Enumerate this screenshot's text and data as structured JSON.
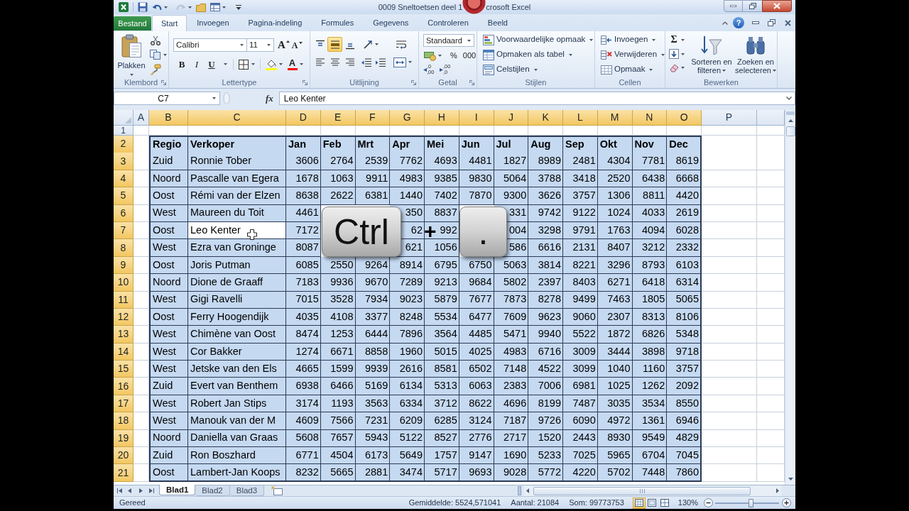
{
  "title_bar": {
    "title_parts": [
      "0009 Sneltoetsen deel 1",
      "crosoft Excel"
    ]
  },
  "ribbon_tabs": [
    {
      "label": "Bestand",
      "kind": "file",
      "selected": false
    },
    {
      "label": "Start",
      "kind": "tab",
      "selected": true
    },
    {
      "label": "Invoegen",
      "kind": "tab",
      "selected": false
    },
    {
      "label": "Pagina-indeling",
      "kind": "tab",
      "selected": false
    },
    {
      "label": "Formules",
      "kind": "tab",
      "selected": false
    },
    {
      "label": "Gegevens",
      "kind": "tab",
      "selected": false
    },
    {
      "label": "Controleren",
      "kind": "tab",
      "selected": false
    },
    {
      "label": "Beeld",
      "kind": "tab",
      "selected": false
    }
  ],
  "window_controls": {
    "help": "?"
  },
  "ribbon": {
    "clipboard": {
      "label": "Klembord",
      "paste": "Plakken"
    },
    "font": {
      "label": "Lettertype",
      "font_name": "Calibri",
      "font_size": "11",
      "size_buttons": [
        {
          "label": "A",
          "kind": "grow"
        },
        {
          "label": "A",
          "kind": "shrink"
        }
      ],
      "style_buttons": [
        {
          "label": "B",
          "kind": "bold"
        },
        {
          "label": "I",
          "kind": "italic"
        },
        {
          "label": "U",
          "kind": "underline"
        }
      ],
      "font_color": "A"
    },
    "alignment": {
      "label": "Uitlijning",
      "vertical": [
        {
          "kind": "top",
          "selected": false
        },
        {
          "kind": "middle",
          "selected": true
        },
        {
          "kind": "bottom",
          "selected": false
        }
      ],
      "horizontal": [
        {
          "kind": "left",
          "selected": false
        },
        {
          "kind": "center",
          "selected": false
        },
        {
          "kind": "right",
          "selected": false
        }
      ]
    },
    "number": {
      "label": "Getal",
      "format": "Standaard",
      "symbols": [
        "%",
        "000"
      ],
      "decimal_buttons": [
        {
          "kind": "increase",
          "top": ",0",
          "bottom": ",00"
        },
        {
          "kind": "decrease",
          "top": ",00",
          "bottom": ",0"
        }
      ]
    },
    "styles": {
      "label": "Stijlen",
      "items": [
        {
          "label": "Voorwaardelijke opmaak",
          "kind": "conditional"
        },
        {
          "label": "Opmaken als tabel",
          "kind": "table"
        },
        {
          "label": "Celstijlen",
          "kind": "cellstyles"
        }
      ]
    },
    "cells": {
      "label": "Cellen",
      "items": [
        {
          "label": "Invoegen",
          "kind": "insert"
        },
        {
          "label": "Verwijderen",
          "kind": "delete"
        },
        {
          "label": "Opmaak",
          "kind": "format"
        }
      ]
    },
    "editing": {
      "label": "Bewerken",
      "sum": "Σ",
      "big_buttons": [
        {
          "kind": "sort",
          "lines": [
            "Sorteren en",
            "filteren"
          ]
        },
        {
          "kind": "find",
          "lines": [
            "Zoeken en",
            "selecteren"
          ]
        }
      ]
    }
  },
  "formula_bar": {
    "name_box": "C7",
    "fx": "fx",
    "formula": "Leo Kenter"
  },
  "sheet": {
    "columns": [
      {
        "label": "A",
        "selected": false,
        "kind": "text"
      },
      {
        "label": "B",
        "selected": true,
        "kind": "text"
      },
      {
        "label": "C",
        "selected": true,
        "kind": "text"
      },
      {
        "label": "D",
        "selected": true,
        "kind": "number"
      },
      {
        "label": "E",
        "selected": true,
        "kind": "number"
      },
      {
        "label": "F",
        "selected": true,
        "kind": "number"
      },
      {
        "label": "G",
        "selected": true,
        "kind": "number"
      },
      {
        "label": "H",
        "selected": true,
        "kind": "number"
      },
      {
        "label": "I",
        "selected": true,
        "kind": "number"
      },
      {
        "label": "J",
        "selected": true,
        "kind": "number"
      },
      {
        "label": "K",
        "selected": true,
        "kind": "number"
      },
      {
        "label": "L",
        "selected": true,
        "kind": "number"
      },
      {
        "label": "M",
        "selected": true,
        "kind": "number"
      },
      {
        "label": "N",
        "selected": true,
        "kind": "number"
      },
      {
        "label": "O",
        "selected": true,
        "kind": "number"
      },
      {
        "label": "P",
        "selected": false,
        "kind": "text"
      }
    ],
    "rows": [
      {
        "number": "1",
        "selected": false,
        "kind": "blank"
      },
      {
        "number": "2",
        "selected": true,
        "kind": "header",
        "cells": [
          null,
          "Regio",
          "Verkoper",
          "Jan",
          "Feb",
          "Mrt",
          "Apr",
          "Mei",
          "Jun",
          "Jul",
          "Aug",
          "Sep",
          "Okt",
          "Nov",
          "Dec",
          null
        ]
      },
      {
        "number": "3",
        "selected": true,
        "kind": "data",
        "cells": [
          null,
          "Zuid",
          "Ronnie Tober",
          "3606",
          "2764",
          "2539",
          "7762",
          "4693",
          "4481",
          "1827",
          "8989",
          "2481",
          "4304",
          "7781",
          "8619",
          null
        ]
      },
      {
        "number": "4",
        "selected": true,
        "kind": "data",
        "cells": [
          null,
          "Noord",
          "Pascalle van Egera",
          "1678",
          "1063",
          "9911",
          "4983",
          "9385",
          "9830",
          "5064",
          "3788",
          "3418",
          "2520",
          "6438",
          "6668",
          null
        ]
      },
      {
        "number": "5",
        "selected": true,
        "kind": "data",
        "cells": [
          null,
          "Oost",
          "Rémi van der Elzen",
          "8638",
          "2622",
          "6381",
          "1440",
          "7402",
          "7870",
          "9300",
          "3626",
          "3757",
          "1306",
          "8811",
          "4420",
          null
        ]
      },
      {
        "number": "6",
        "selected": true,
        "kind": "data",
        "cells": [
          null,
          "West",
          "Maureen du Toit",
          "4461",
          null,
          null,
          "350",
          "8837",
          null,
          "331",
          "9742",
          "9122",
          "1024",
          "4033",
          "2619",
          null
        ]
      },
      {
        "number": "7",
        "selected": true,
        "kind": "data",
        "cells": [
          null,
          "Oost",
          {
            "text": "Leo Kenter",
            "active": true
          },
          "7172",
          null,
          null,
          "62",
          "992",
          null,
          "004",
          "3298",
          "9791",
          "1763",
          "4094",
          "6028",
          null
        ]
      },
      {
        "number": "8",
        "selected": true,
        "kind": "data",
        "cells": [
          null,
          "West",
          "Ezra van Groninge",
          "8087",
          null,
          null,
          "621",
          "1056",
          null,
          "586",
          "6616",
          "2131",
          "8407",
          "3212",
          "2332",
          null
        ]
      },
      {
        "number": "9",
        "selected": true,
        "kind": "data",
        "cells": [
          null,
          "Oost",
          "Joris Putman",
          "6085",
          "2550",
          "9264",
          "8914",
          "6795",
          "6750",
          "5063",
          "3814",
          "8221",
          "3296",
          "8793",
          "6103",
          null
        ]
      },
      {
        "number": "10",
        "selected": true,
        "kind": "data",
        "cells": [
          null,
          "Noord",
          "Dione de Graaff",
          "7183",
          "9936",
          "9670",
          "7289",
          "9213",
          "9684",
          "5802",
          "2397",
          "8403",
          "6271",
          "6418",
          "6314",
          null
        ]
      },
      {
        "number": "11",
        "selected": true,
        "kind": "data",
        "cells": [
          null,
          "West",
          "Gigi Ravelli",
          "7015",
          "3528",
          "7934",
          "9023",
          "5879",
          "7677",
          "7873",
          "8278",
          "9499",
          "7463",
          "1805",
          "5065",
          null
        ]
      },
      {
        "number": "12",
        "selected": true,
        "kind": "data",
        "cells": [
          null,
          "Oost",
          "Ferry Hoogendijk",
          "4035",
          "4108",
          "3377",
          "8248",
          "5534",
          "6477",
          "7609",
          "9623",
          "9060",
          "2307",
          "8313",
          "8106",
          null
        ]
      },
      {
        "number": "13",
        "selected": true,
        "kind": "data",
        "cells": [
          null,
          "West",
          "Chimène van Oost",
          "8474",
          "1253",
          "6444",
          "7896",
          "3564",
          "4485",
          "5471",
          "9940",
          "5522",
          "1872",
          "6826",
          "5348",
          null
        ]
      },
      {
        "number": "14",
        "selected": true,
        "kind": "data",
        "cells": [
          null,
          "West",
          "Cor Bakker",
          "1274",
          "6671",
          "8858",
          "1960",
          "5015",
          "4025",
          "4983",
          "6716",
          "3009",
          "3444",
          "3898",
          "9718",
          null
        ]
      },
      {
        "number": "15",
        "selected": true,
        "kind": "data",
        "cells": [
          null,
          "West",
          "Jetske van den Els",
          "4665",
          "1599",
          "9939",
          "2616",
          "8581",
          "6502",
          "7148",
          "4522",
          "3099",
          "1040",
          "1160",
          "3757",
          null
        ]
      },
      {
        "number": "16",
        "selected": true,
        "kind": "data",
        "cells": [
          null,
          "Zuid",
          "Evert van Benthem",
          "6938",
          "6466",
          "5169",
          "6134",
          "5313",
          "6063",
          "2383",
          "7006",
          "6981",
          "1025",
          "1262",
          "2092",
          null
        ]
      },
      {
        "number": "17",
        "selected": true,
        "kind": "data",
        "cells": [
          null,
          "West",
          "Robert Jan Stips",
          "3174",
          "1193",
          "3563",
          "6334",
          "3712",
          "8622",
          "4696",
          "8199",
          "7487",
          "3035",
          "3534",
          "8550",
          null
        ]
      },
      {
        "number": "18",
        "selected": true,
        "kind": "data",
        "cells": [
          null,
          "West",
          "Manouk van der M",
          "4609",
          "7566",
          "7231",
          "6209",
          "6285",
          "3124",
          "7187",
          "9726",
          "6090",
          "4972",
          "1361",
          "6946",
          null
        ]
      },
      {
        "number": "19",
        "selected": true,
        "kind": "data",
        "cells": [
          null,
          "Noord",
          "Daniella van Graas",
          "5608",
          "7657",
          "5943",
          "5122",
          "8527",
          "2776",
          "2717",
          "1520",
          "2443",
          "8930",
          "9549",
          "4829",
          null
        ]
      },
      {
        "number": "20",
        "selected": true,
        "kind": "data",
        "cells": [
          null,
          "Zuid",
          "Ron Boszhard",
          "6771",
          "4504",
          "6173",
          "5649",
          "1757",
          "9147",
          "1690",
          "5233",
          "7025",
          "5965",
          "6704",
          "7045",
          null
        ]
      },
      {
        "number": "21",
        "selected": true,
        "kind": "data",
        "cells": [
          null,
          "Oost",
          "Lambert-Jan Koops",
          "8232",
          "5665",
          "2881",
          "3474",
          "5717",
          "9693",
          "9028",
          "5772",
          "4220",
          "5702",
          "7448",
          "7860",
          null
        ]
      }
    ]
  },
  "keystroke_overlay": {
    "keys": [
      "Ctrl",
      "."
    ],
    "separator": "+"
  },
  "sheet_tabs": [
    {
      "label": "Blad1",
      "selected": true
    },
    {
      "label": "Blad2",
      "selected": false
    },
    {
      "label": "Blad3",
      "selected": false
    }
  ],
  "status_bar": {
    "status": "Gereed",
    "average": "Gemiddelde: 5524,571041",
    "count": "Aantal: 21084",
    "sum": "Som: 99773753",
    "views": [
      {
        "kind": "normal",
        "selected": true
      },
      {
        "kind": "page_layout",
        "selected": false
      },
      {
        "kind": "page_break",
        "selected": false
      }
    ],
    "zoom": "130%",
    "zoom_slider": {
      "level": 0.55
    }
  }
}
